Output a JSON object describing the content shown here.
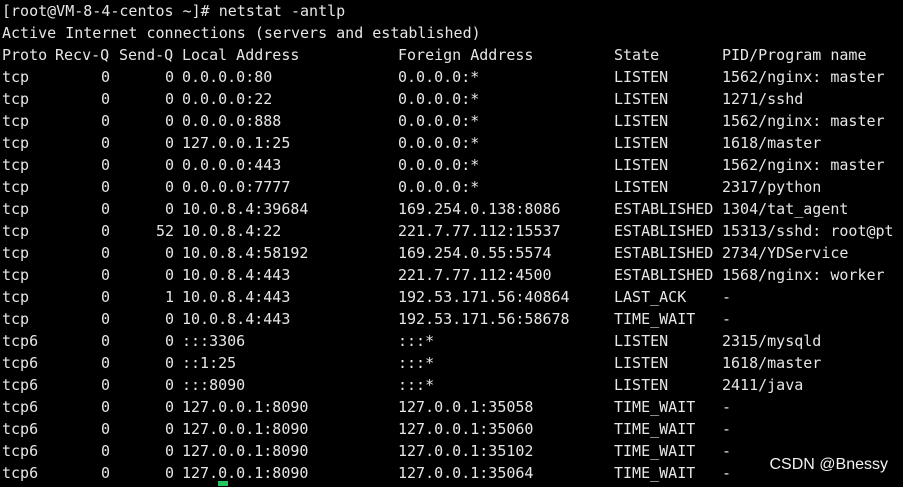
{
  "terminal": {
    "prompt": "[root@VM-8-4-centos ~]# netstat -antlp",
    "info": "Active Internet connections (servers and established)",
    "headers": {
      "proto": "Proto",
      "recvq": "Recv-Q",
      "sendq": "Send-Q",
      "local": "Local Address",
      "foreign": "Foreign Address",
      "state": "State",
      "pid": "PID/Program name"
    },
    "rows": [
      {
        "proto": "tcp",
        "recvq": "0",
        "sendq": "0",
        "local": "0.0.0.0:80",
        "foreign": "0.0.0.0:*",
        "state": "LISTEN",
        "pid": "1562/nginx: master"
      },
      {
        "proto": "tcp",
        "recvq": "0",
        "sendq": "0",
        "local": "0.0.0.0:22",
        "foreign": "0.0.0.0:*",
        "state": "LISTEN",
        "pid": "1271/sshd"
      },
      {
        "proto": "tcp",
        "recvq": "0",
        "sendq": "0",
        "local": "0.0.0.0:888",
        "foreign": "0.0.0.0:*",
        "state": "LISTEN",
        "pid": "1562/nginx: master"
      },
      {
        "proto": "tcp",
        "recvq": "0",
        "sendq": "0",
        "local": "127.0.0.1:25",
        "foreign": "0.0.0.0:*",
        "state": "LISTEN",
        "pid": "1618/master"
      },
      {
        "proto": "tcp",
        "recvq": "0",
        "sendq": "0",
        "local": "0.0.0.0:443",
        "foreign": "0.0.0.0:*",
        "state": "LISTEN",
        "pid": "1562/nginx: master"
      },
      {
        "proto": "tcp",
        "recvq": "0",
        "sendq": "0",
        "local": "0.0.0.0:7777",
        "foreign": "0.0.0.0:*",
        "state": "LISTEN",
        "pid": "2317/python"
      },
      {
        "proto": "tcp",
        "recvq": "0",
        "sendq": "0",
        "local": "10.0.8.4:39684",
        "foreign": "169.254.0.138:8086",
        "state": "ESTABLISHED",
        "pid": "1304/tat_agent"
      },
      {
        "proto": "tcp",
        "recvq": "0",
        "sendq": "52",
        "local": "10.0.8.4:22",
        "foreign": "221.7.77.112:15537",
        "state": "ESTABLISHED",
        "pid": "15313/sshd: root@pt"
      },
      {
        "proto": "tcp",
        "recvq": "0",
        "sendq": "0",
        "local": "10.0.8.4:58192",
        "foreign": "169.254.0.55:5574",
        "state": "ESTABLISHED",
        "pid": "2734/YDService"
      },
      {
        "proto": "tcp",
        "recvq": "0",
        "sendq": "0",
        "local": "10.0.8.4:443",
        "foreign": "221.7.77.112:4500",
        "state": "ESTABLISHED",
        "pid": "1568/nginx: worker"
      },
      {
        "proto": "tcp",
        "recvq": "0",
        "sendq": "1",
        "local": "10.0.8.4:443",
        "foreign": "192.53.171.56:40864",
        "state": "LAST_ACK",
        "pid": "-"
      },
      {
        "proto": "tcp",
        "recvq": "0",
        "sendq": "0",
        "local": "10.0.8.4:443",
        "foreign": "192.53.171.56:58678",
        "state": "TIME_WAIT",
        "pid": "-"
      },
      {
        "proto": "tcp6",
        "recvq": "0",
        "sendq": "0",
        "local": ":::3306",
        "foreign": ":::*",
        "state": "LISTEN",
        "pid": "2315/mysqld"
      },
      {
        "proto": "tcp6",
        "recvq": "0",
        "sendq": "0",
        "local": "::1:25",
        "foreign": ":::*",
        "state": "LISTEN",
        "pid": "1618/master"
      },
      {
        "proto": "tcp6",
        "recvq": "0",
        "sendq": "0",
        "local": ":::8090",
        "foreign": ":::*",
        "state": "LISTEN",
        "pid": "2411/java"
      },
      {
        "proto": "tcp6",
        "recvq": "0",
        "sendq": "0",
        "local": "127.0.0.1:8090",
        "foreign": "127.0.0.1:35058",
        "state": "TIME_WAIT",
        "pid": "-"
      },
      {
        "proto": "tcp6",
        "recvq": "0",
        "sendq": "0",
        "local": "127.0.0.1:8090",
        "foreign": "127.0.0.1:35060",
        "state": "TIME_WAIT",
        "pid": "-"
      },
      {
        "proto": "tcp6",
        "recvq": "0",
        "sendq": "0",
        "local": "127.0.0.1:8090",
        "foreign": "127.0.0.1:35102",
        "state": "TIME_WAIT",
        "pid": "-"
      },
      {
        "proto": "tcp6",
        "recvq": "0",
        "sendq": "0",
        "local": "127.0.0.1:8090",
        "foreign": "127.0.0.1:35064",
        "state": "TIME_WAIT",
        "pid": "-"
      }
    ]
  },
  "watermark": "CSDN @Bnessy"
}
